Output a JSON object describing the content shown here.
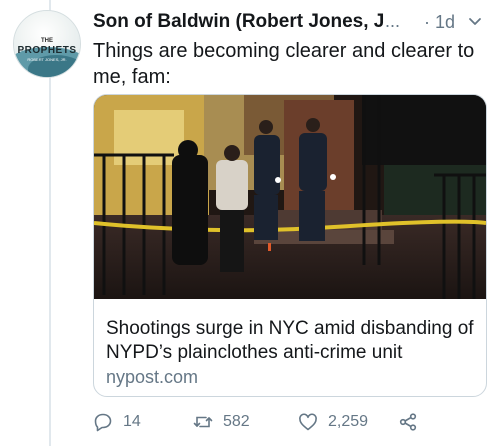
{
  "tweet": {
    "author_name": "Son of Baldwin (Robert Jones, Jr.)",
    "more_label": "...",
    "time": "· 1d",
    "text": "Things are becoming clearer and clearer to me, fam:"
  },
  "avatar": {
    "line1": "THE",
    "line2": "PROPHETS",
    "line3": "ROBERT JONES, JR."
  },
  "card": {
    "title": "Shootings surge in NYC amid disbanding of NYPD’s plainclothes anti-crime unit",
    "domain": "nypost.com"
  },
  "actions": {
    "replies": "14",
    "retweets": "582",
    "likes": "2,259"
  },
  "colors": {
    "text": "#14171a",
    "muted": "#657786",
    "border": "#ccd6dd"
  }
}
